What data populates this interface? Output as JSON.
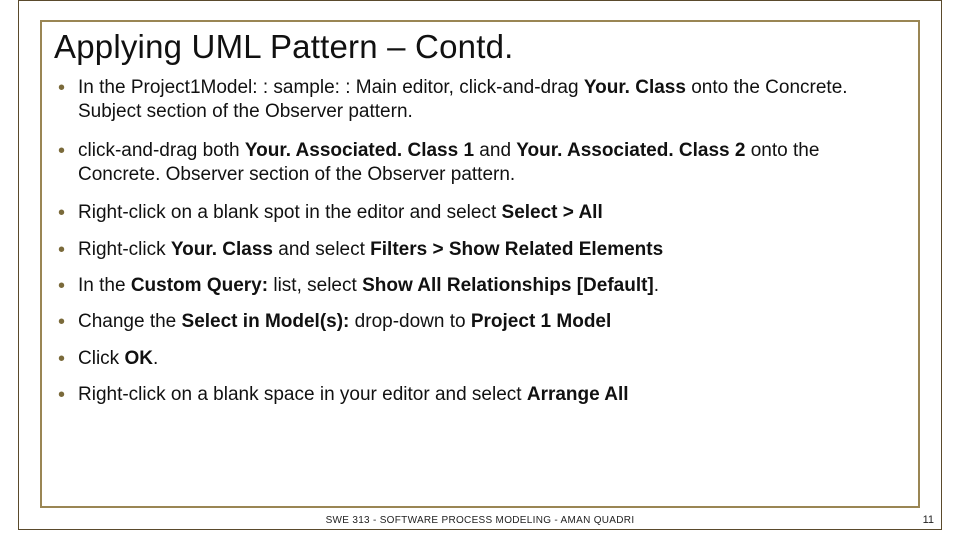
{
  "title": "Applying UML Pattern – Contd.",
  "bullets": {
    "b1": {
      "t1": "In the Project1Model: : sample: : Main editor, click-and-drag ",
      "b1": "Your. Class",
      "t2": " onto the Concrete. Subject section of the Observer pattern."
    },
    "b2": {
      "t1": "click-and-drag both ",
      "b1": "Your. Associated. Class 1",
      "t2": " and ",
      "b2": "Your. Associated. Class 2",
      "t3": " onto the Concrete. Observer section of the Observer pattern."
    },
    "b3": {
      "t1": "Right-click on a blank spot in the editor and select ",
      "b1": "Select > All"
    },
    "b4": {
      "t1": "Right-click ",
      "b1": "Your. Class",
      "t2": " and select ",
      "b2": "Filters > Show Related Elements"
    },
    "b5": {
      "t1": "In the ",
      "b1": "Custom Query:",
      "t2": " list, select ",
      "b2": "Show All Relationships [Default]",
      "t3": "."
    },
    "b6": {
      "t1": "Change the ",
      "b1": "Select in Model(s):",
      "t2": " drop-down to ",
      "b2": "Project 1 Model"
    },
    "b7": {
      "t1": "Click ",
      "b1": "OK",
      "t2": "."
    },
    "b8": {
      "t1": "Right-click on a blank space in your editor and select ",
      "b1": "Arrange All"
    }
  },
  "footer": "SWE 313 - SOFTWARE PROCESS MODELING - AMAN QUADRI",
  "page_number": "11"
}
